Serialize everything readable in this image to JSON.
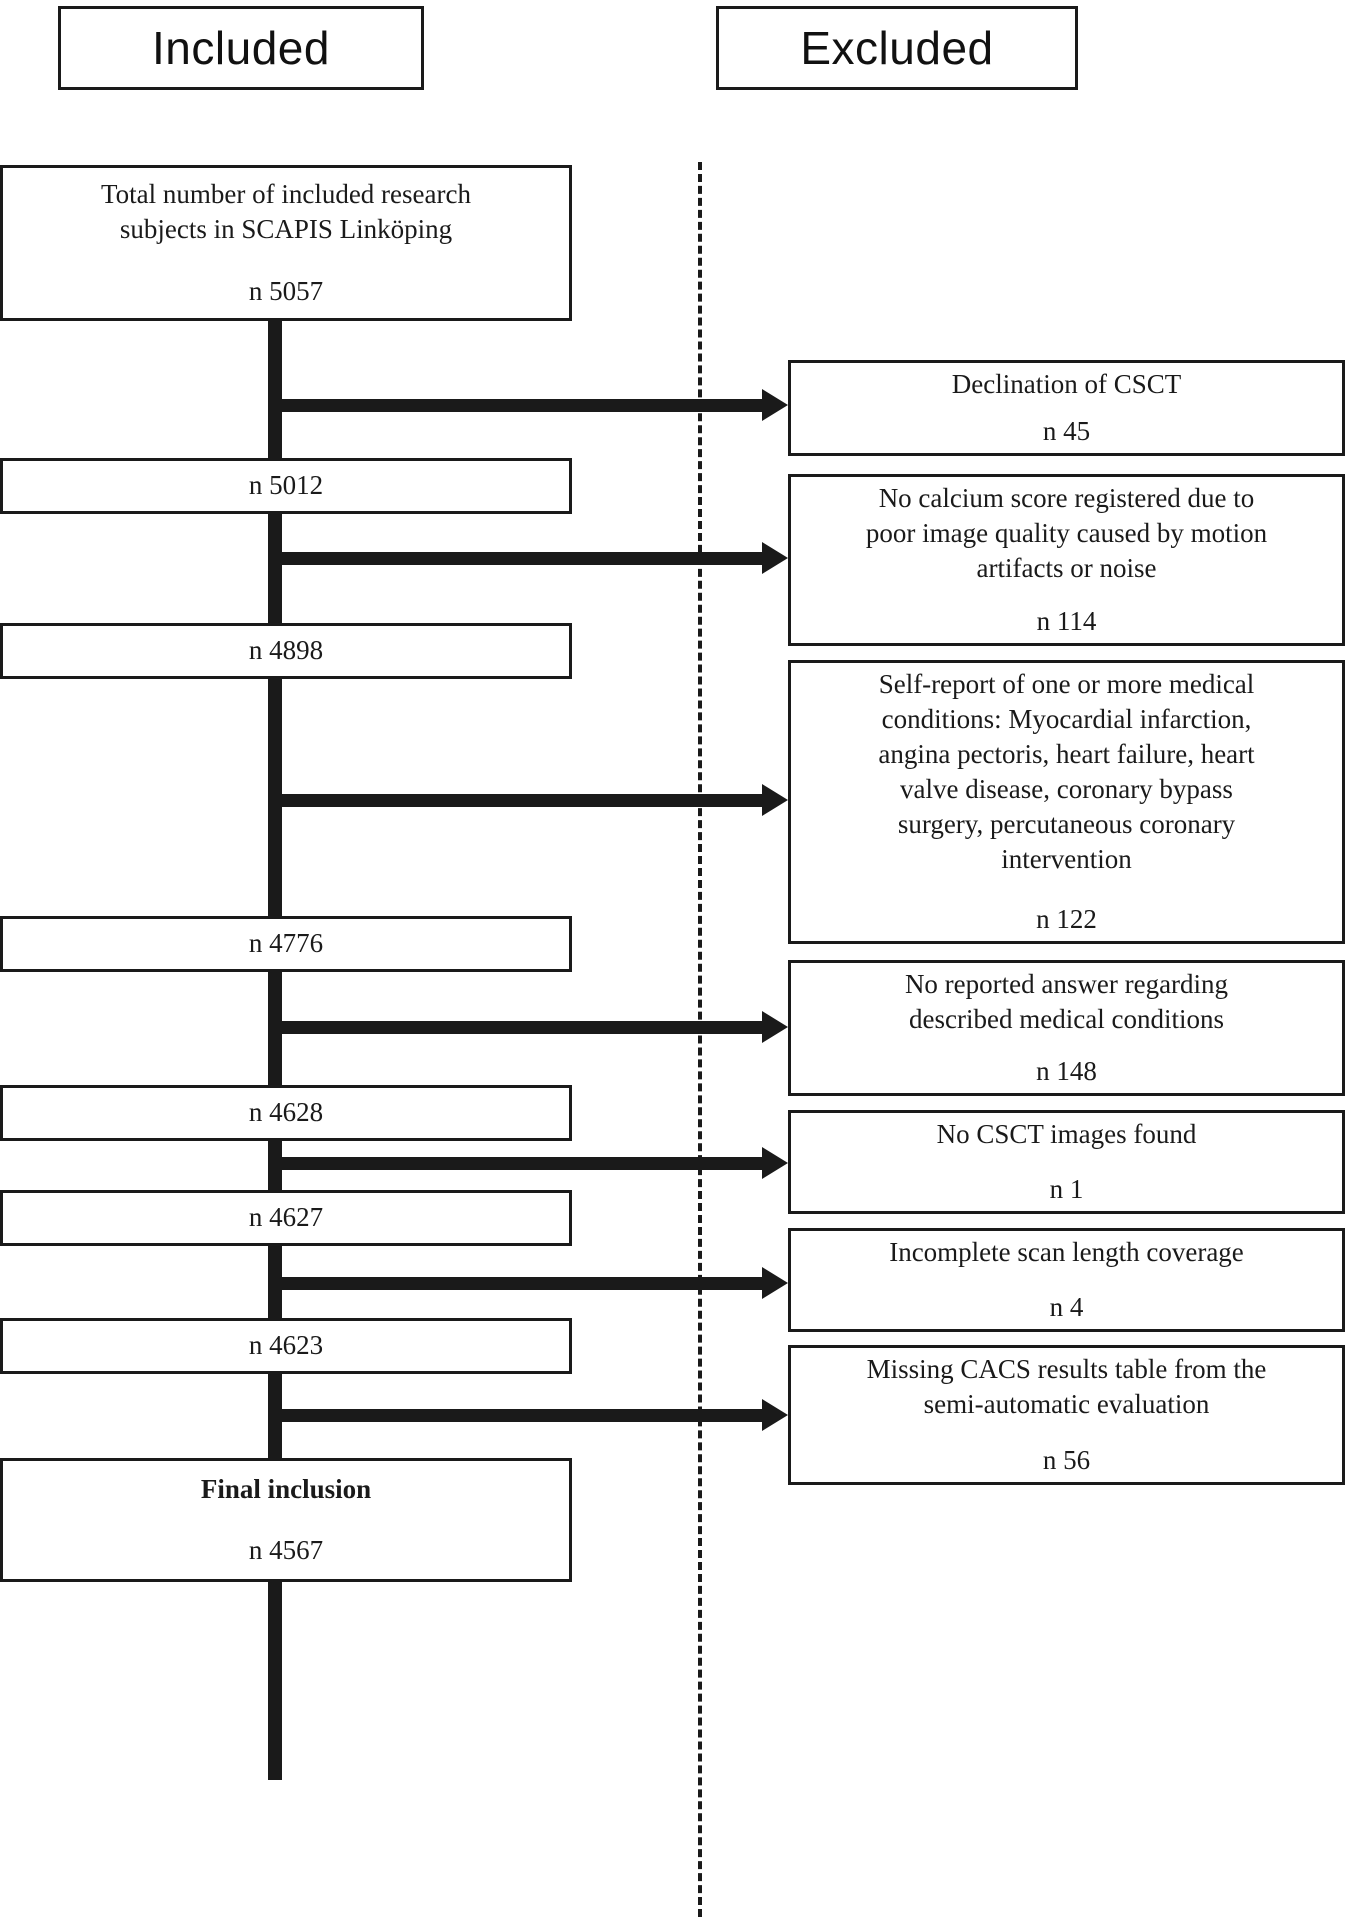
{
  "headers": {
    "included": "Included",
    "excluded": "Excluded"
  },
  "included_nodes": [
    {
      "id": "total-included",
      "text": "Total number of included research\nsubjects in SCAPIS Linköping",
      "count": "n 5057",
      "bold": false
    },
    {
      "id": "after-declination",
      "text": "",
      "count": "n 5012",
      "bold": false
    },
    {
      "id": "after-no-calcium-score",
      "text": "",
      "count": "n 4898",
      "bold": false
    },
    {
      "id": "after-self-report",
      "text": "",
      "count": "n 4776",
      "bold": false
    },
    {
      "id": "after-no-answer",
      "text": "",
      "count": "n 4628",
      "bold": false
    },
    {
      "id": "after-no-images",
      "text": "",
      "count": "n 4627",
      "bold": false
    },
    {
      "id": "after-incomplete-scan",
      "text": "",
      "count": "n 4623",
      "bold": false
    },
    {
      "id": "final-inclusion",
      "text": "Final inclusion",
      "count": "n 4567",
      "bold": true
    }
  ],
  "excluded_nodes": [
    {
      "id": "declination-of-csct",
      "text": "Declination of CSCT",
      "count": "n 45"
    },
    {
      "id": "no-calcium-score",
      "text": "No calcium score registered due to\npoor image quality caused by motion\nartifacts or noise",
      "count": "n 114"
    },
    {
      "id": "self-report-medical-conditions",
      "text": "Self-report of one or more medical\nconditions: Myocardial infarction,\nangina pectoris, heart failure, heart\nvalve disease, coronary bypass\nsurgery, percutaneous coronary\nintervention",
      "count": "n 122"
    },
    {
      "id": "no-reported-answer",
      "text": "No reported answer regarding\ndescribed medical conditions",
      "count": "n 148"
    },
    {
      "id": "no-csct-images-found",
      "text": "No CSCT images found",
      "count": "n 1"
    },
    {
      "id": "incomplete-scan-length",
      "text": "Incomplete scan length coverage",
      "count": "n 4"
    },
    {
      "id": "missing-cacs-results",
      "text": "Missing CACS results table from the\nsemi-automatic evaluation",
      "count": "n 56"
    }
  ],
  "colors": {
    "line": "#1a1a1a",
    "background": "#ffffff",
    "text": "#1a1a1a"
  }
}
